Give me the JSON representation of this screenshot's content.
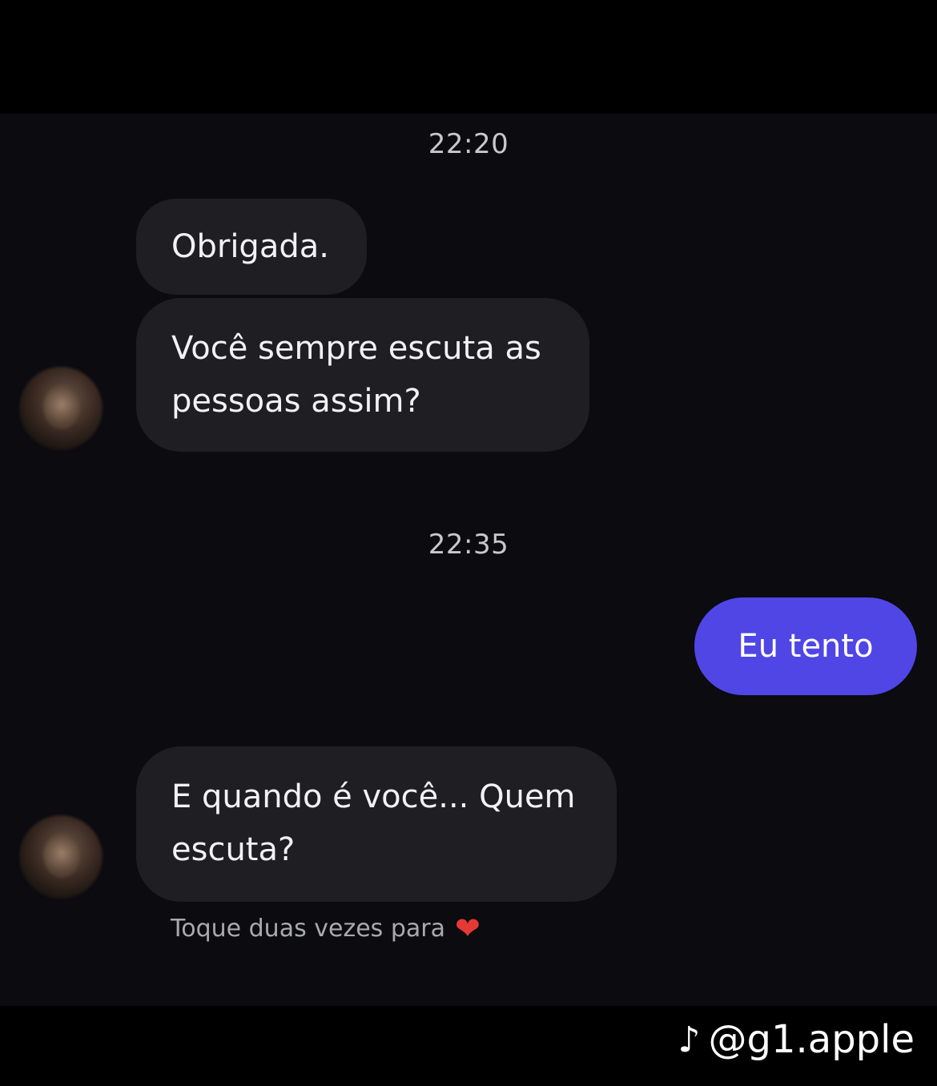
{
  "chat": {
    "timestamps": [
      "22:20",
      "22:35"
    ],
    "messages": [
      {
        "id": "m1",
        "direction": "incoming",
        "lines": [
          "Obrigada."
        ]
      },
      {
        "id": "m2",
        "direction": "incoming",
        "lines": [
          "Você sempre escuta as",
          "pessoas assim?"
        ]
      },
      {
        "id": "m3",
        "direction": "outgoing",
        "lines": [
          "Eu tento"
        ]
      },
      {
        "id": "m4",
        "direction": "incoming",
        "lines": [
          "E quando é você... Quem",
          "escuta?"
        ]
      }
    ],
    "hint": "Toque duas vezes para",
    "hint_icon": "heart-icon"
  },
  "watermark": {
    "icon": "tiktok-note-icon",
    "handle": "@g1.apple"
  },
  "colors": {
    "background": "#0b0b10",
    "incoming_bubble": "#1e1e23",
    "outgoing_bubble": "#4f46e5",
    "heart": "#e53935"
  }
}
